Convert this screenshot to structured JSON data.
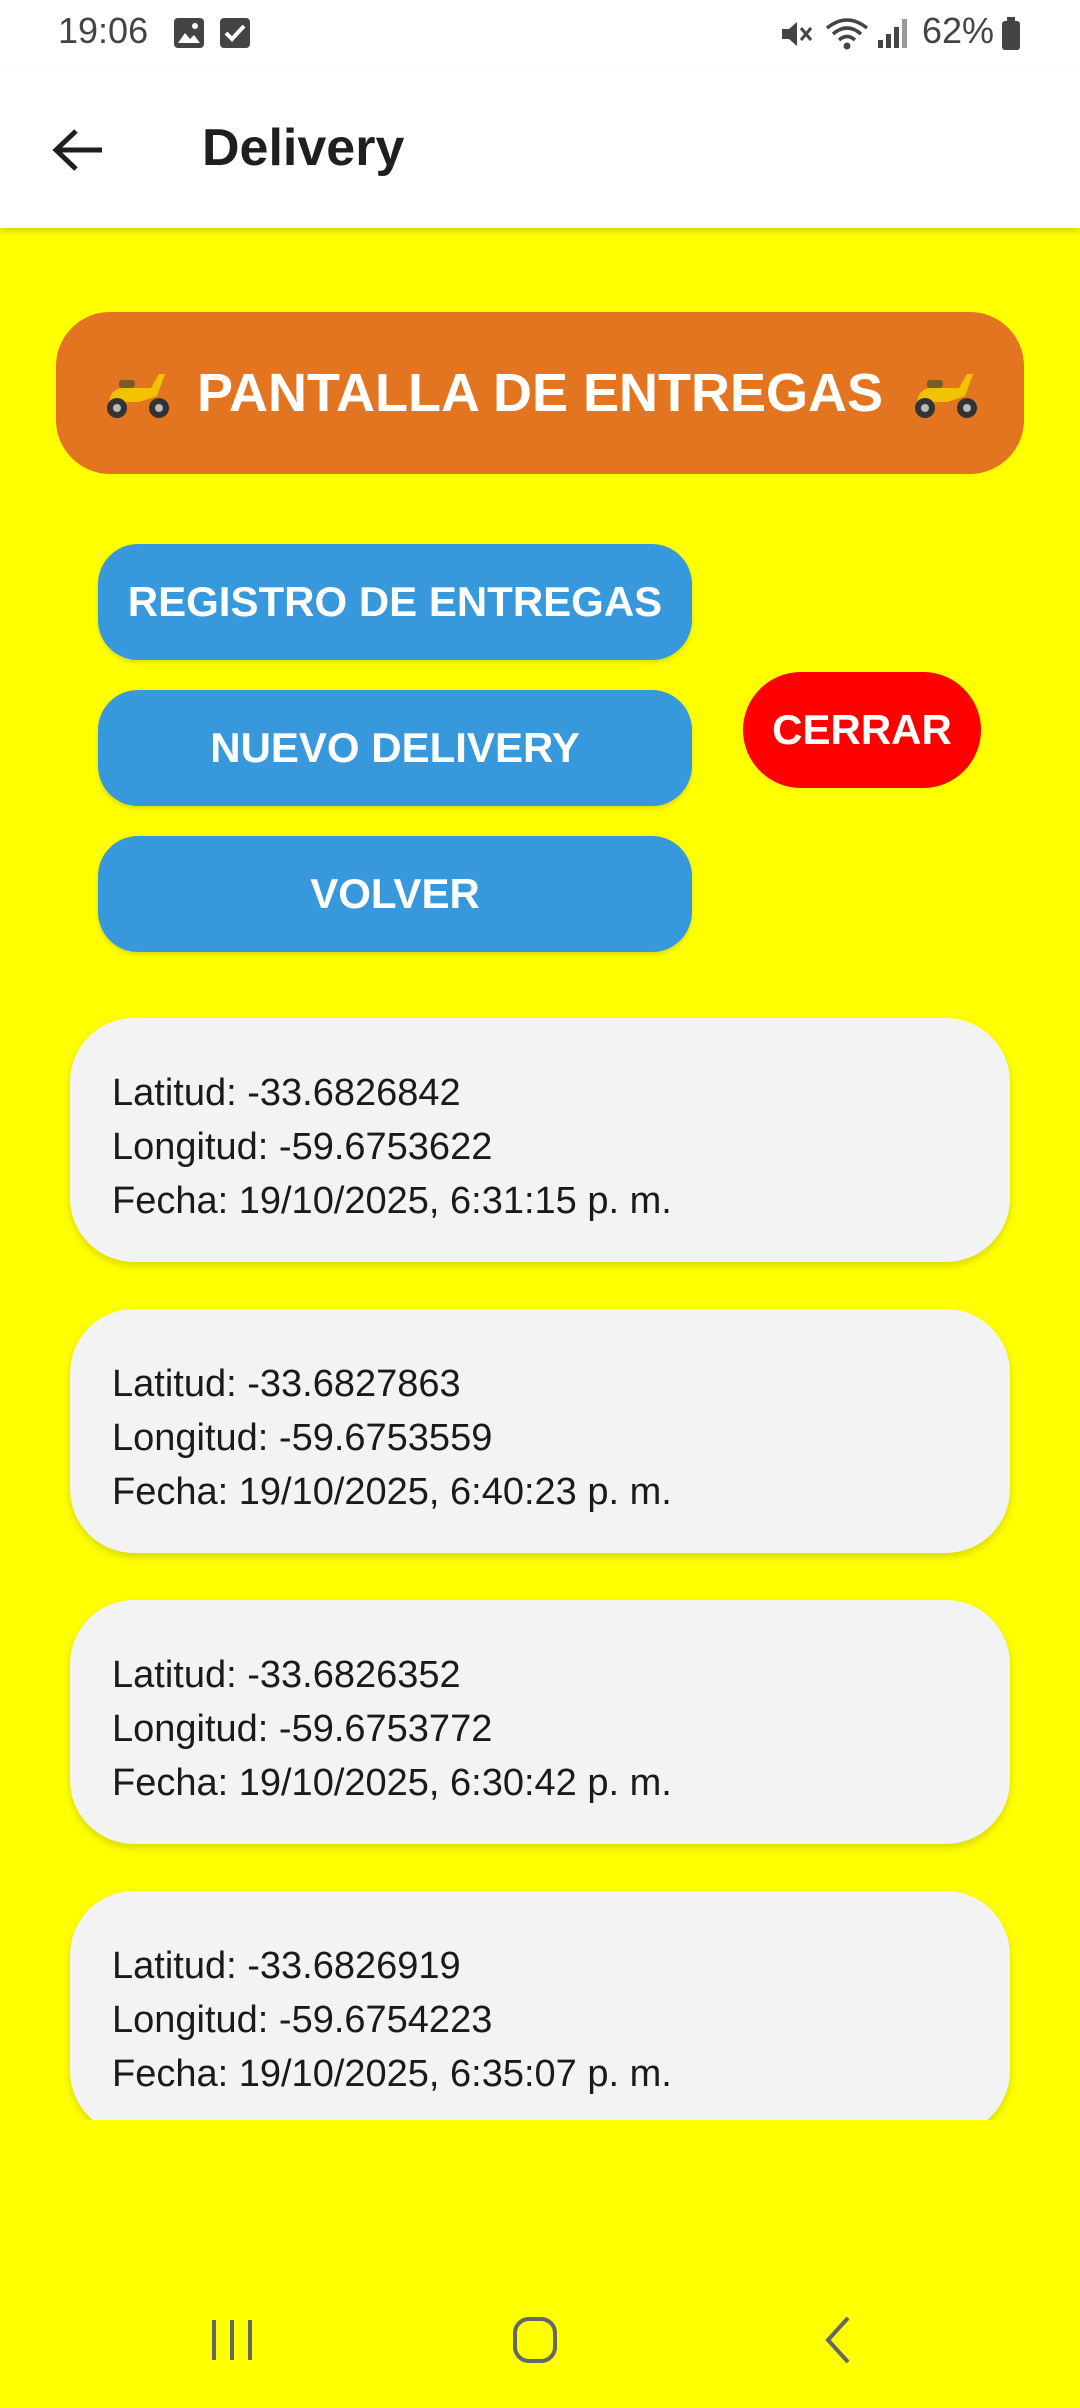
{
  "status_bar": {
    "time": "19:06",
    "battery": "62%",
    "icons": [
      "image-icon",
      "checkbox-icon",
      "mute-icon",
      "wifi-icon",
      "signal-icon",
      "battery-icon"
    ]
  },
  "app_bar": {
    "title": "Delivery",
    "back_icon": "arrow-left-icon"
  },
  "banner": {
    "title": "PANTALLA DE ENTREGAS",
    "icon": "scooter-icon"
  },
  "buttons": {
    "registro": "REGISTRO DE ENTREGAS",
    "nuevo": "NUEVO DELIVERY",
    "volver": "VOLVER",
    "cerrar": "CERRAR"
  },
  "deliveries": [
    {
      "lat": "Latitud: -33.6826842",
      "lng": "Longitud: -59.6753622",
      "date": "Fecha: 19/10/2025, 6:31:15 p. m."
    },
    {
      "lat": "Latitud: -33.6827863",
      "lng": "Longitud: -59.6753559",
      "date": "Fecha: 19/10/2025, 6:40:23 p. m."
    },
    {
      "lat": "Latitud: -33.6826352",
      "lng": "Longitud: -59.6753772",
      "date": "Fecha: 19/10/2025, 6:30:42 p. m."
    },
    {
      "lat": "Latitud: -33.6826919",
      "lng": "Longitud: -59.6754223",
      "date": "Fecha: 19/10/2025, 6:35:07 p. m."
    }
  ],
  "colors": {
    "background": "#FFFF00",
    "banner": "#E37521",
    "primary_button": "#3799DB",
    "close_button": "#FF0000",
    "card": "#F3F3F3"
  },
  "nav_bar": {
    "icons": [
      "recents-icon",
      "home-icon",
      "back-icon"
    ]
  }
}
